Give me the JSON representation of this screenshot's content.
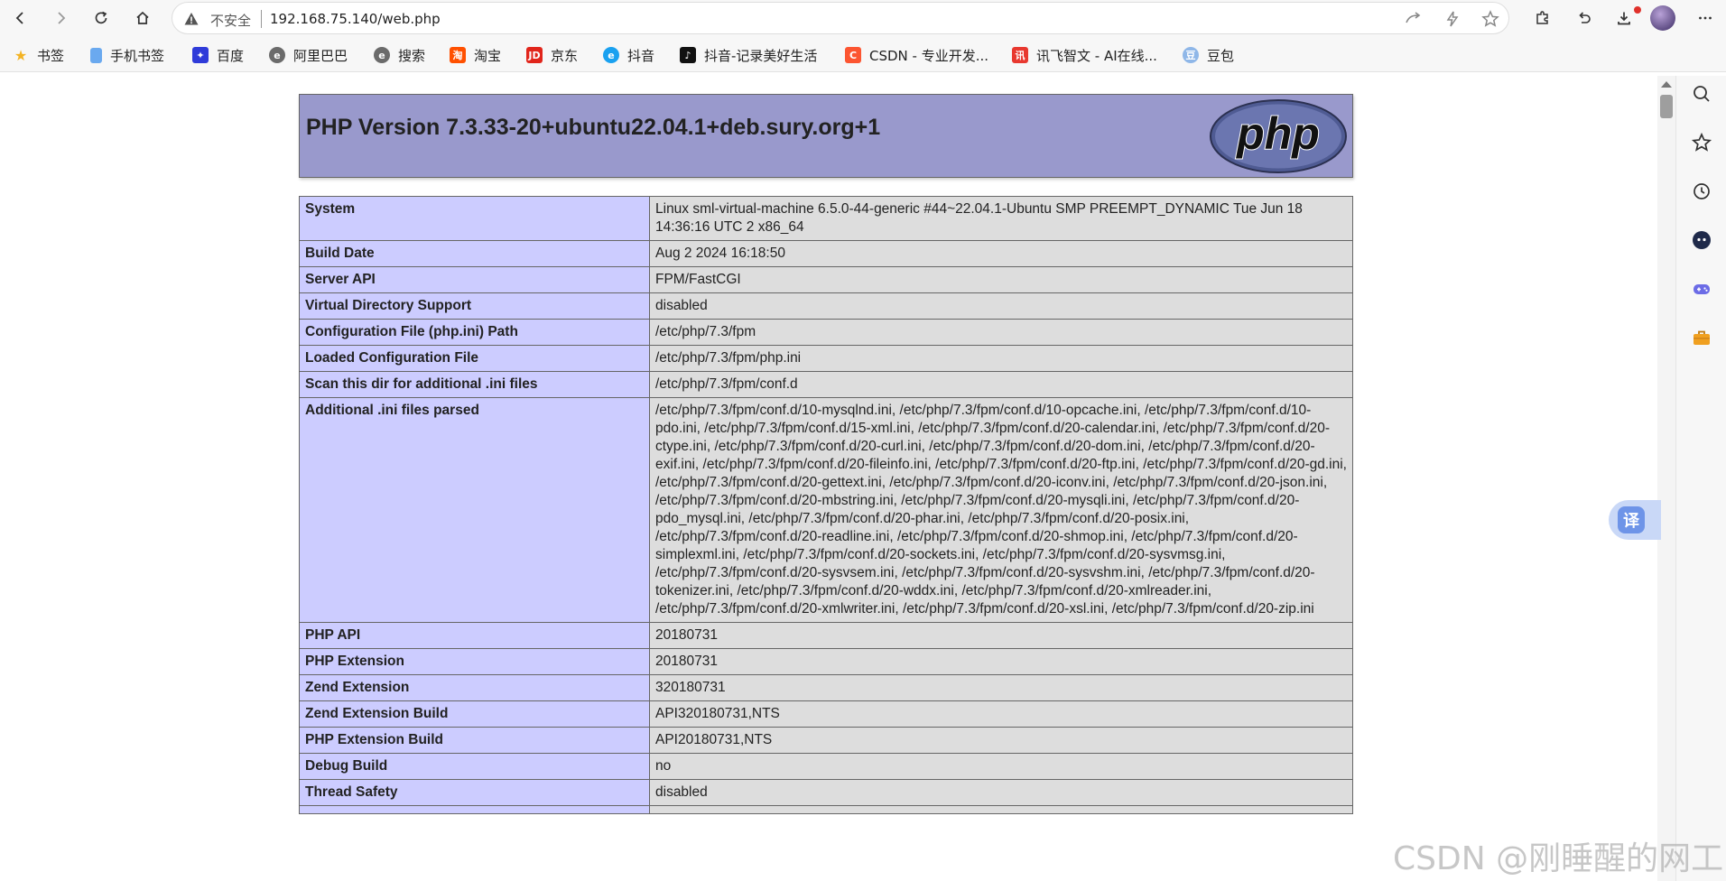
{
  "browser": {
    "insecure_label": "不安全",
    "url": "192.168.75.140/web.php"
  },
  "bookmarks": [
    {
      "label": "书签",
      "icon": "star-icon",
      "color": "#f3b324"
    },
    {
      "label": "手机书签",
      "icon": "folder-icon",
      "color": "#4a90e2"
    },
    {
      "label": "百度",
      "icon": "baidu-icon",
      "color": "#2f3bd9"
    },
    {
      "label": "阿里巴巴",
      "icon": "alibaba-icon",
      "color": "#666666"
    },
    {
      "label": "搜索",
      "icon": "search-engine-icon",
      "color": "#666666"
    },
    {
      "label": "淘宝",
      "icon": "taobao-icon",
      "color": "#ff5000"
    },
    {
      "label": "京东",
      "icon": "jd-icon",
      "color": "#e1251b"
    },
    {
      "label": "抖音",
      "icon": "douyin-icon",
      "color": "#1aa1f0"
    },
    {
      "label": "抖音-记录美好生活",
      "icon": "tiktok-icon",
      "color": "#111111"
    },
    {
      "label": "CSDN - 专业开发...",
      "icon": "csdn-icon",
      "color": "#fc5531"
    },
    {
      "label": "讯飞智文 - AI在线...",
      "icon": "xunfei-icon",
      "color": "#e8382f"
    },
    {
      "label": "豆包",
      "icon": "doubao-icon",
      "color": "#8fb7e8"
    }
  ],
  "php": {
    "version_title": "PHP Version 7.3.33-20+ubuntu22.04.1+deb.sury.org+1",
    "logo_text": "php",
    "rows": [
      {
        "key": "System",
        "value": "Linux sml-virtual-machine 6.5.0-44-generic #44~22.04.1-Ubuntu SMP PREEMPT_DYNAMIC Tue Jun 18 14:36:16 UTC 2 x86_64"
      },
      {
        "key": "Build Date",
        "value": "Aug 2 2024 16:18:50"
      },
      {
        "key": "Server API",
        "value": "FPM/FastCGI"
      },
      {
        "key": "Virtual Directory Support",
        "value": "disabled"
      },
      {
        "key": "Configuration File (php.ini) Path",
        "value": "/etc/php/7.3/fpm"
      },
      {
        "key": "Loaded Configuration File",
        "value": "/etc/php/7.3/fpm/php.ini"
      },
      {
        "key": "Scan this dir for additional .ini files",
        "value": "/etc/php/7.3/fpm/conf.d"
      },
      {
        "key": "Additional .ini files parsed",
        "value": "/etc/php/7.3/fpm/conf.d/10-mysqlnd.ini, /etc/php/7.3/fpm/conf.d/10-opcache.ini, /etc/php/7.3/fpm/conf.d/10-pdo.ini, /etc/php/7.3/fpm/conf.d/15-xml.ini, /etc/php/7.3/fpm/conf.d/20-calendar.ini, /etc/php/7.3/fpm/conf.d/20-ctype.ini, /etc/php/7.3/fpm/conf.d/20-curl.ini, /etc/php/7.3/fpm/conf.d/20-dom.ini, /etc/php/7.3/fpm/conf.d/20-exif.ini, /etc/php/7.3/fpm/conf.d/20-fileinfo.ini, /etc/php/7.3/fpm/conf.d/20-ftp.ini, /etc/php/7.3/fpm/conf.d/20-gd.ini, /etc/php/7.3/fpm/conf.d/20-gettext.ini, /etc/php/7.3/fpm/conf.d/20-iconv.ini, /etc/php/7.3/fpm/conf.d/20-json.ini, /etc/php/7.3/fpm/conf.d/20-mbstring.ini, /etc/php/7.3/fpm/conf.d/20-mysqli.ini, /etc/php/7.3/fpm/conf.d/20-pdo_mysql.ini, /etc/php/7.3/fpm/conf.d/20-phar.ini, /etc/php/7.3/fpm/conf.d/20-posix.ini, /etc/php/7.3/fpm/conf.d/20-readline.ini, /etc/php/7.3/fpm/conf.d/20-shmop.ini, /etc/php/7.3/fpm/conf.d/20-simplexml.ini, /etc/php/7.3/fpm/conf.d/20-sockets.ini, /etc/php/7.3/fpm/conf.d/20-sysvmsg.ini, /etc/php/7.3/fpm/conf.d/20-sysvsem.ini, /etc/php/7.3/fpm/conf.d/20-sysvshm.ini, /etc/php/7.3/fpm/conf.d/20-tokenizer.ini, /etc/php/7.3/fpm/conf.d/20-wddx.ini, /etc/php/7.3/fpm/conf.d/20-xmlreader.ini, /etc/php/7.3/fpm/conf.d/20-xmlwriter.ini, /etc/php/7.3/fpm/conf.d/20-xsl.ini, /etc/php/7.3/fpm/conf.d/20-zip.ini"
      },
      {
        "key": "PHP API",
        "value": "20180731"
      },
      {
        "key": "PHP Extension",
        "value": "20180731"
      },
      {
        "key": "Zend Extension",
        "value": "320180731"
      },
      {
        "key": "Zend Extension Build",
        "value": "API320180731,NTS"
      },
      {
        "key": "PHP Extension Build",
        "value": "API20180731,NTS"
      },
      {
        "key": "Debug Build",
        "value": "no"
      },
      {
        "key": "Thread Safety",
        "value": "disabled"
      }
    ]
  },
  "translate_label": "译",
  "watermark": "CSDN @刚睡醒的网工",
  "colors": {
    "header_bg": "#9999cc",
    "key_cell_bg": "#ccccff",
    "value_cell_bg": "#dddddd"
  }
}
